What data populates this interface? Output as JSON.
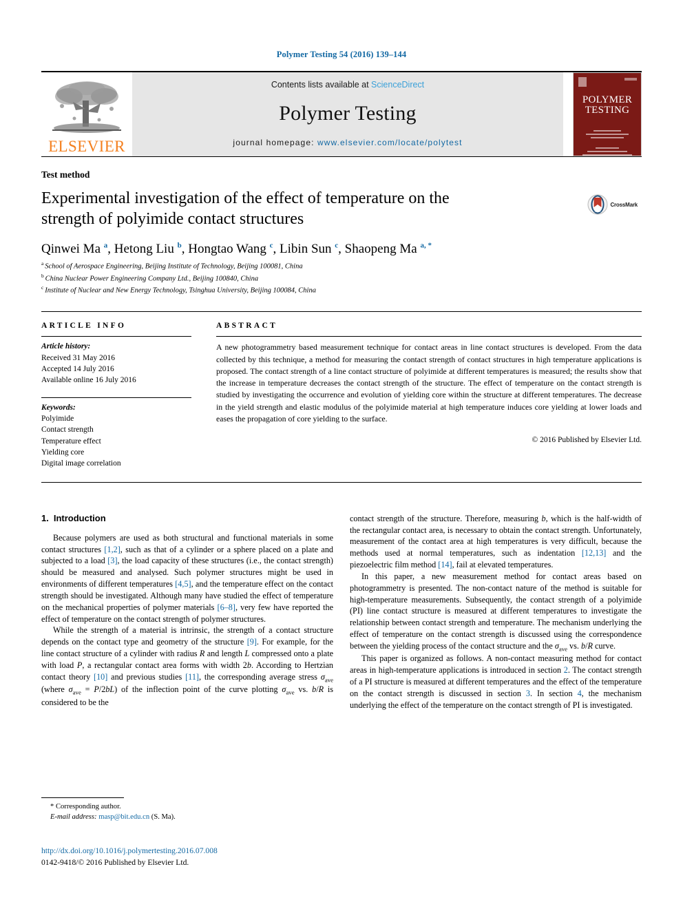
{
  "running_head": "Polymer Testing 54 (2016) 139–144",
  "masthead": {
    "publisher_logo_text": "ELSEVIER",
    "contents_prefix": "Contents lists available at ",
    "contents_link": "ScienceDirect",
    "journal_name": "Polymer Testing",
    "homepage_prefix": "journal homepage: ",
    "homepage_url": "www.elsevier.com/locate/polytest",
    "cover_title_line1": "POLYMER",
    "cover_title_line2": "TESTING"
  },
  "article": {
    "section_kind": "Test method",
    "title": "Experimental investigation of the effect of temperature on the strength of polyimide contact structures",
    "crossmark_label": "CrossMark",
    "authors": [
      {
        "name": "Qinwei Ma",
        "marks": "a"
      },
      {
        "name": "Hetong Liu",
        "marks": "b"
      },
      {
        "name": "Hongtao Wang",
        "marks": "c"
      },
      {
        "name": "Libin Sun",
        "marks": "c"
      },
      {
        "name": "Shaopeng Ma",
        "marks": "a, *"
      }
    ],
    "affiliations": [
      {
        "mark": "a",
        "text": "School of Aerospace Engineering, Beijing Institute of Technology, Beijing 100081, China"
      },
      {
        "mark": "b",
        "text": "China Nuclear Power Engineering Company Ltd., Beijing 100840, China"
      },
      {
        "mark": "c",
        "text": "Institute of Nuclear and New Energy Technology, Tsinghua University, Beijing 100084, China"
      }
    ]
  },
  "article_info": {
    "heading": "ARTICLE INFO",
    "history_label": "Article history:",
    "history": [
      "Received 31 May 2016",
      "Accepted 14 July 2016",
      "Available online 16 July 2016"
    ],
    "keywords_label": "Keywords:",
    "keywords": [
      "Polyimide",
      "Contact strength",
      "Temperature effect",
      "Yielding core",
      "Digital image correlation"
    ]
  },
  "abstract": {
    "heading": "ABSTRACT",
    "text": "A new photogrammetry based measurement technique for contact areas in line contact structures is developed. From the data collected by this technique, a method for measuring the contact strength of contact structures in high temperature applications is proposed. The contact strength of a line contact structure of polyimide at different temperatures is measured; the results show that the increase in temperature decreases the contact strength of the structure. The effect of temperature on the contact strength is studied by investigating the occurrence and evolution of yielding core within the structure at different temperatures. The decrease in the yield strength and elastic modulus of the polyimide material at high temperature induces core yielding at lower loads and eases the propagation of core yielding to the surface.",
    "copyright": "© 2016 Published by Elsevier Ltd."
  },
  "introduction": {
    "number": "1.",
    "title": "Introduction",
    "left_paragraphs": [
      "Because polymers are used as both structural and functional materials in some contact structures [1,2], such as that of a cylinder or a sphere placed on a plate and subjected to a load [3], the load capacity of these structures (i.e., the contact strength) should be measured and analysed. Such polymer structures might be used in environments of different temperatures [4,5], and the temperature effect on the contact strength should be investigated. Although many have studied the effect of temperature on the mechanical properties of polymer materials [6–8], very few have reported the effect of temperature on the contact strength of polymer structures.",
      "While the strength of a material is intrinsic, the strength of a contact structure depends on the contact type and geometry of the structure [9]. For example, for the line contact structure of a cylinder with radius R and length L compressed onto a plate with load P, a rectangular contact area forms with width 2b. According to Hertzian contact theory [10] and previous studies [11], the corresponding average stress σave (where σave = P/2bL) of the inflection point of the curve plotting σave vs. b/R is considered to be the"
    ],
    "right_paragraphs": [
      "contact strength of the structure. Therefore, measuring b, which is the half-width of the rectangular contact area, is necessary to obtain the contact strength. Unfortunately, measurement of the contact area at high temperatures is very difficult, because the methods used at normal temperatures, such as indentation [12,13] and the piezoelectric film method [14], fail at elevated temperatures.",
      "In this paper, a new measurement method for contact areas based on photogrammetry is presented. The non-contact nature of the method is suitable for high-temperature measurements. Subsequently, the contact strength of a polyimide (PI) line contact structure is measured at different temperatures to investigate the relationship between contact strength and temperature. The mechanism underlying the effect of temperature on the contact strength is discussed using the correspondence between the yielding process of the contact structure and the σave vs. b/R curve.",
      "This paper is organized as follows. A non-contact measuring method for contact areas in high-temperature applications is introduced in section 2. The contact strength of a PI structure is measured at different temperatures and the effect of the temperature on the contact strength is discussed in section 3. In section 4, the mechanism underlying the effect of the temperature on the contact strength of PI is investigated."
    ]
  },
  "footnote": {
    "corresponding": "* Corresponding author.",
    "email_label": "E-mail address:",
    "email": "masp@bit.edu.cn",
    "email_suffix": "(S. Ma)."
  },
  "footer": {
    "doi": "http://dx.doi.org/10.1016/j.polymertesting.2016.07.008",
    "issn_line": "0142-9418/© 2016 Published by Elsevier Ltd."
  },
  "colors": {
    "link": "#1268a3",
    "sciencedirect": "#3aa0d8",
    "elsevier_orange": "#f4801f",
    "cover_red": "#7b1a16",
    "masthead_gray": "#e6e6e6"
  }
}
